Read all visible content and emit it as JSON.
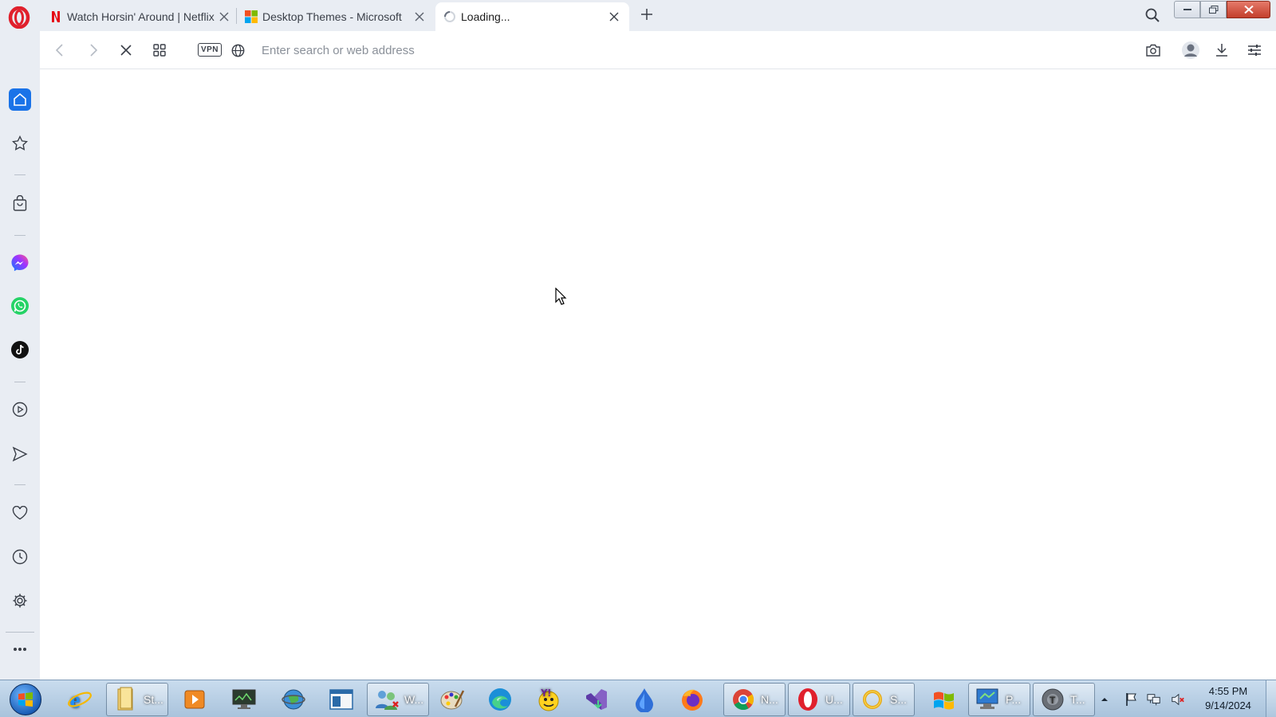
{
  "browser": {
    "tabs": [
      {
        "title": "Watch Horsin' Around | Netflix",
        "favicon": "netflix-icon",
        "active": false
      },
      {
        "title": "Desktop Themes - Microsoft",
        "favicon": "microsoft-icon",
        "active": false
      },
      {
        "title": "Loading...",
        "favicon": "loading-spinner-icon",
        "active": true
      }
    ],
    "address_bar": {
      "value": "",
      "placeholder": "Enter search or web address"
    },
    "vpn_label": "VPN"
  },
  "sidebar": {
    "items": [
      "home",
      "speed-dial",
      "shopping",
      "messenger",
      "whatsapp",
      "tiktok",
      "player",
      "flow",
      "pinboards",
      "history",
      "settings",
      "more"
    ]
  },
  "taskbar": {
    "items": [
      {
        "icon": "internet-explorer-icon",
        "label": ""
      },
      {
        "icon": "folder-icon",
        "label": "St..."
      },
      {
        "icon": "media-player-icon",
        "label": ""
      },
      {
        "icon": "monitor-icon",
        "label": ""
      },
      {
        "icon": "globe-icon",
        "label": ""
      },
      {
        "icon": "window-icon",
        "label": ""
      },
      {
        "icon": "users-icon",
        "label": "W..."
      },
      {
        "icon": "paint-icon",
        "label": ""
      },
      {
        "icon": "edge-icon",
        "label": ""
      },
      {
        "icon": "yahoo-messenger-icon",
        "label": ""
      },
      {
        "icon": "visual-studio-installer-icon",
        "label": ""
      },
      {
        "icon": "droplet-icon",
        "label": ""
      },
      {
        "icon": "firefox-icon",
        "label": ""
      },
      {
        "icon": "chrome-icon",
        "label": "N..."
      },
      {
        "icon": "opera-icon",
        "label": "U..."
      },
      {
        "icon": "ring-icon",
        "label": "S..."
      },
      {
        "icon": "windows-flag-icon",
        "label": ""
      },
      {
        "icon": "remote-desktop-icon",
        "label": "P..."
      },
      {
        "icon": "gray-app-icon",
        "label": "T..."
      }
    ],
    "clock": {
      "time": "4:55 PM",
      "date": "9/14/2024"
    }
  },
  "colors": {
    "accent": "#1a73e8",
    "opera_red": "#e0202c",
    "sidebar_bg": "#e9edf3"
  }
}
